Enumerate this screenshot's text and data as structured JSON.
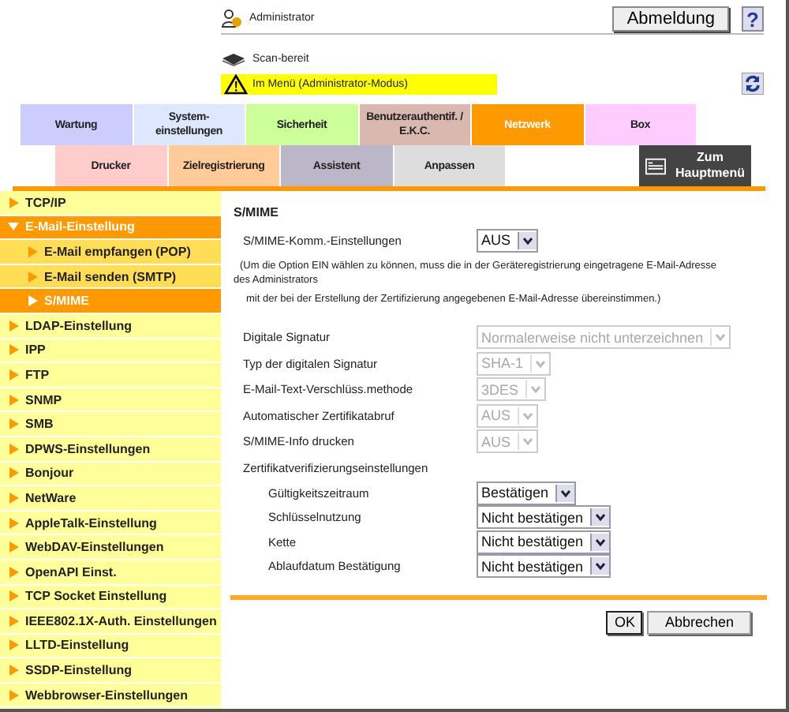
{
  "header": {
    "user": "Administrator",
    "logout_button": "Abmeldung",
    "help_button": "?",
    "status": "Scan-bereit",
    "alert": "Im Menü (Administrator-Modus)"
  },
  "tabs_row_1": [
    {
      "label": "Wartung",
      "color": "#ccccff",
      "selected": false
    },
    {
      "label": "System-\neinstellungen",
      "color": "#dde8ff",
      "selected": false
    },
    {
      "label": "Sicherheit",
      "color": "#ccff99",
      "selected": false
    },
    {
      "label": "Benutzerauthentif. /\nE.K.C.",
      "color": "#d9b8b0",
      "selected": false
    },
    {
      "label": "Netzwerk",
      "color": "#ff9900",
      "selected": true
    },
    {
      "label": "Box",
      "color": "#ffccff",
      "selected": false
    }
  ],
  "tabs_row_2": [
    {
      "label": "Drucker",
      "color": "#ffcccc",
      "selected": false
    },
    {
      "label": "Zielregistrierung",
      "color": "#ffcc99",
      "selected": false
    },
    {
      "label": "Assistent",
      "color": "#bbb6c8",
      "selected": false
    },
    {
      "label": "Anpassen",
      "color": "#dddddd",
      "selected": false
    }
  ],
  "main_menu_button": "Zum\nHauptmenü",
  "sidebar": {
    "items": [
      {
        "label": "TCP/IP",
        "selected": false
      },
      {
        "label": "E-Mail-Einstellung",
        "expanded": true,
        "children": [
          {
            "label": "E-Mail empfangen (POP)",
            "selected": false
          },
          {
            "label": "E-Mail senden (SMTP)",
            "selected": false
          },
          {
            "label": "S/MIME",
            "selected": true
          }
        ]
      },
      {
        "label": "LDAP-Einstellung",
        "selected": false
      },
      {
        "label": "IPP",
        "selected": false
      },
      {
        "label": "FTP",
        "selected": false
      },
      {
        "label": "SNMP",
        "selected": false
      },
      {
        "label": "SMB",
        "selected": false
      },
      {
        "label": "DPWS-Einstellungen",
        "selected": false
      },
      {
        "label": "Bonjour",
        "selected": false
      },
      {
        "label": "NetWare",
        "selected": false
      },
      {
        "label": "AppleTalk-Einstellung",
        "selected": false
      },
      {
        "label": "WebDAV-Einstellungen",
        "selected": false
      },
      {
        "label": "OpenAPI Einst.",
        "selected": false
      },
      {
        "label": "TCP Socket Einstellung",
        "selected": false
      },
      {
        "label": "IEEE802.1X-Auth. Einstellungen",
        "selected": false
      },
      {
        "label": "LLTD-Einstellung",
        "selected": false
      },
      {
        "label": "SSDP-Einstellung",
        "selected": false
      },
      {
        "label": "Webbrowser-Einstellungen",
        "selected": false
      }
    ]
  },
  "content": {
    "title": "S/MIME",
    "comm_setting": {
      "label": "S/MIME-Komm.-Einstellungen",
      "value": "AUS",
      "disabled": false
    },
    "notes": [
      "(Um die Option EIN wählen zu können, muss die in der Geräteregistrierung eingetragene E-Mail-Adresse",
      "des Administrators",
      "mit der bei der Erstellung der Zertifizierung angegebenen E-Mail-Adresse übereinstimmen.)"
    ],
    "settings": [
      {
        "label": "Digitale Signatur",
        "value": "Normalerweise nicht unterzeichnen",
        "disabled": true
      },
      {
        "label": "Typ der digitalen Signatur",
        "value": "SHA-1",
        "disabled": true
      },
      {
        "label": "E-Mail-Text-Verschlüss.methode",
        "value": "3DES",
        "disabled": true
      },
      {
        "label": "Automatischer Zertifikatabruf",
        "value": "AUS",
        "disabled": true
      },
      {
        "label": "S/MIME-Info drucken",
        "value": "AUS",
        "disabled": true
      },
      {
        "label": "Zertifikatverifizierungseinstellungen",
        "children": [
          {
            "label": "Gültigkeitszeitraum",
            "value": "Bestätigen",
            "disabled": false
          },
          {
            "label": "Schlüsselnutzung",
            "value": "Nicht bestätigen",
            "disabled": false
          },
          {
            "label": "Kette",
            "value": "Nicht bestätigen",
            "disabled": false
          },
          {
            "label": "Ablaufdatum Bestätigung",
            "value": "Nicht bestätigen",
            "disabled": false
          }
        ]
      }
    ],
    "buttons": [
      "OK",
      "Abbrechen"
    ]
  }
}
